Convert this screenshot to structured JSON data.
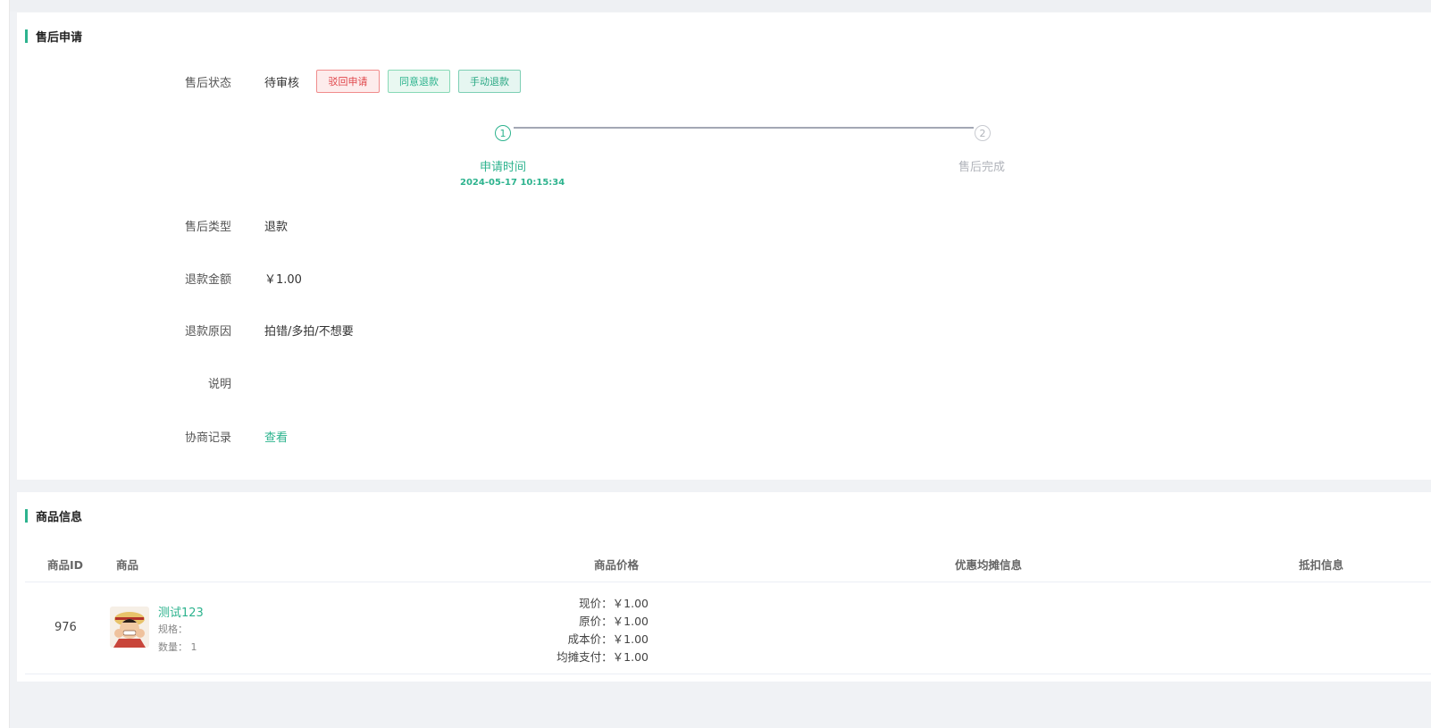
{
  "aftersale": {
    "section_title": "售后申请",
    "status_label": "售后状态",
    "status_value": "待审核",
    "buttons": {
      "reject": "驳回申请",
      "agree": "同意退款",
      "manual": "手动退款"
    },
    "steps": [
      {
        "index": "1",
        "title": "申请时间",
        "time": "2024-05-17 10:15:34"
      },
      {
        "index": "2",
        "title": "售后完成"
      }
    ],
    "type_label": "售后类型",
    "type_value": "退款",
    "amount_label": "退款金额",
    "amount_value": "￥1.00",
    "reason_label": "退款原因",
    "reason_value": "拍错/多拍/不想要",
    "note_label": "说明",
    "note_value": "",
    "negotiation_label": "协商记录",
    "negotiation_link": "查看"
  },
  "goods": {
    "section_title": "商品信息",
    "columns": [
      "商品ID",
      "商品",
      "商品价格",
      "优惠均摊信息",
      "抵扣信息"
    ],
    "row": {
      "id": "976",
      "name": "测试123",
      "spec": "规格：",
      "quantity": "数量： 1",
      "price_current": "现价：￥1.00",
      "price_original": "原价：￥1.00",
      "price_cost": "成本价：￥1.00",
      "price_shared": "均摊支付：￥1.00"
    }
  },
  "colors": {
    "accent": "#2db38e",
    "danger": "#e0474c"
  }
}
